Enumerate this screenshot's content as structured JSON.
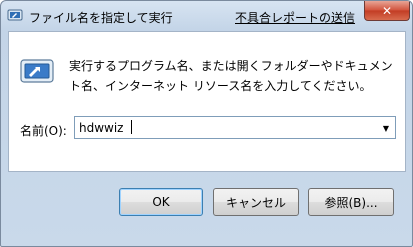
{
  "window": {
    "title": "ファイル名を指定して実行",
    "report_link": "不具合レポートの送信",
    "close_glyph": "✕"
  },
  "content": {
    "description": "実行するプログラム名、または開くフォルダーやドキュメント名、インターネット リソース名を入力してください。",
    "name_label": "名前(O):",
    "name_value": "hdwwiz",
    "dropdown_glyph": "▼"
  },
  "buttons": {
    "ok": "OK",
    "cancel": "キャンセル",
    "browse": "参照(B)..."
  },
  "icons": {
    "title": "run-icon",
    "content": "run-icon"
  }
}
